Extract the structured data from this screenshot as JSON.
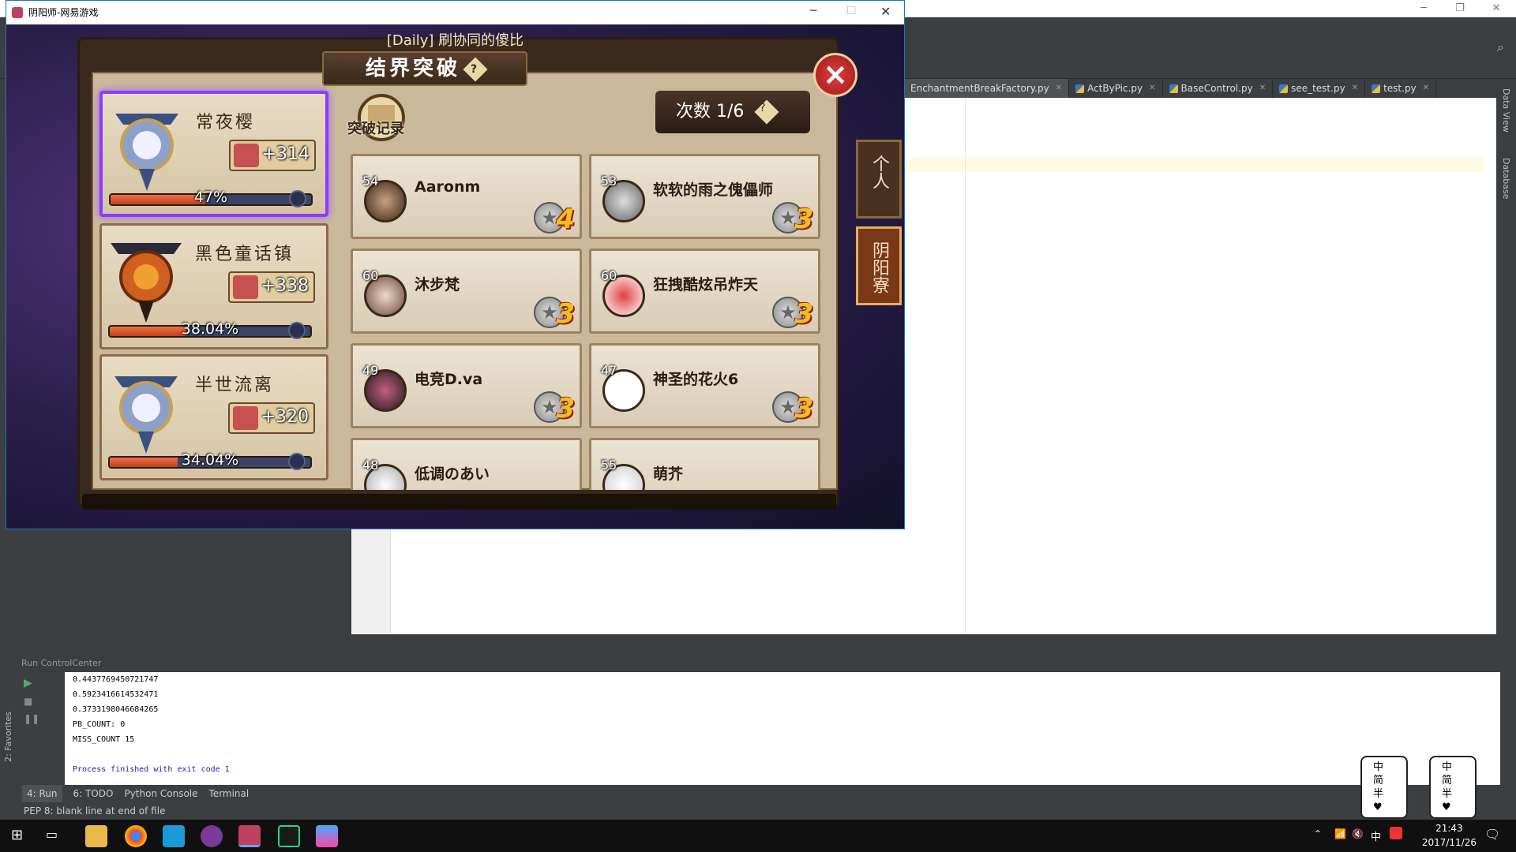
{
  "game": {
    "window_title": "阴阳师-网易游戏",
    "daily_banner": "[Daily] 刷协同的傻比",
    "panel_title": "结界突破",
    "records_label": "突破记录",
    "attempts": "次数 1/6",
    "help": "?",
    "close": "×",
    "guilds": [
      {
        "name": "常夜樱",
        "reward": "+314",
        "progress_label": "47%",
        "progress": 0.47
      },
      {
        "name": "黑色童话镇",
        "reward": "+338",
        "progress_label": "38.04%",
        "progress": 0.3804
      },
      {
        "name": "半世流离",
        "reward": "+320",
        "progress_label": "34.04%",
        "progress": 0.3404
      }
    ],
    "opponents": [
      {
        "level": "54",
        "name": "Aaronm",
        "medals": "4"
      },
      {
        "level": "53",
        "name": "软软的雨之傀儡师",
        "medals": "3"
      },
      {
        "level": "60",
        "name": "沐步梵",
        "medals": "3"
      },
      {
        "level": "60",
        "name": "狂拽酷炫吊炸天",
        "medals": "3"
      },
      {
        "level": "49",
        "name": "电竞D.va",
        "medals": "3"
      },
      {
        "level": "47",
        "name": "神圣的花火6",
        "medals": "3"
      },
      {
        "level": "48",
        "name": "低调のあい",
        "medals": ""
      },
      {
        "level": "55",
        "name": "萌芥",
        "medals": ""
      }
    ],
    "side_tabs": [
      {
        "label": "个人"
      },
      {
        "label": "阴阳寮"
      }
    ]
  },
  "ide": {
    "editor_tabs": [
      {
        "label": "EnchantmentBreakFactory.py"
      },
      {
        "label": "ActByPic.py"
      },
      {
        "label": "BaseControl.py"
      },
      {
        "label": "see_test.py"
      },
      {
        "label": "test.py"
      }
    ],
    "right_labels": [
      "Data View",
      "Database"
    ],
    "run_header": "Run  ControlCenter",
    "console_lines": [
      "0.4437769450721747",
      "0.5923416614532471",
      "0.3733198046684265",
      "PB_COUNT: 0",
      "MISS_COUNT 15",
      "",
      "Process finished with exit code 1"
    ],
    "favorites_label": "2: Favorites",
    "bottom_tabs": [
      {
        "label": "4: Run"
      },
      {
        "label": "6: TODO"
      },
      {
        "label": "Python Console"
      },
      {
        "label": "Terminal"
      }
    ],
    "status": "PEP 8: blank line at end of file"
  },
  "taskbar": {
    "time": "21:43",
    "date": "2017/11/26",
    "ime": "中",
    "sticker_text": "中\n简\n半\n♥"
  },
  "colors": {
    "accent": "#1c73c7",
    "selected_guild": "#8a3cff"
  }
}
